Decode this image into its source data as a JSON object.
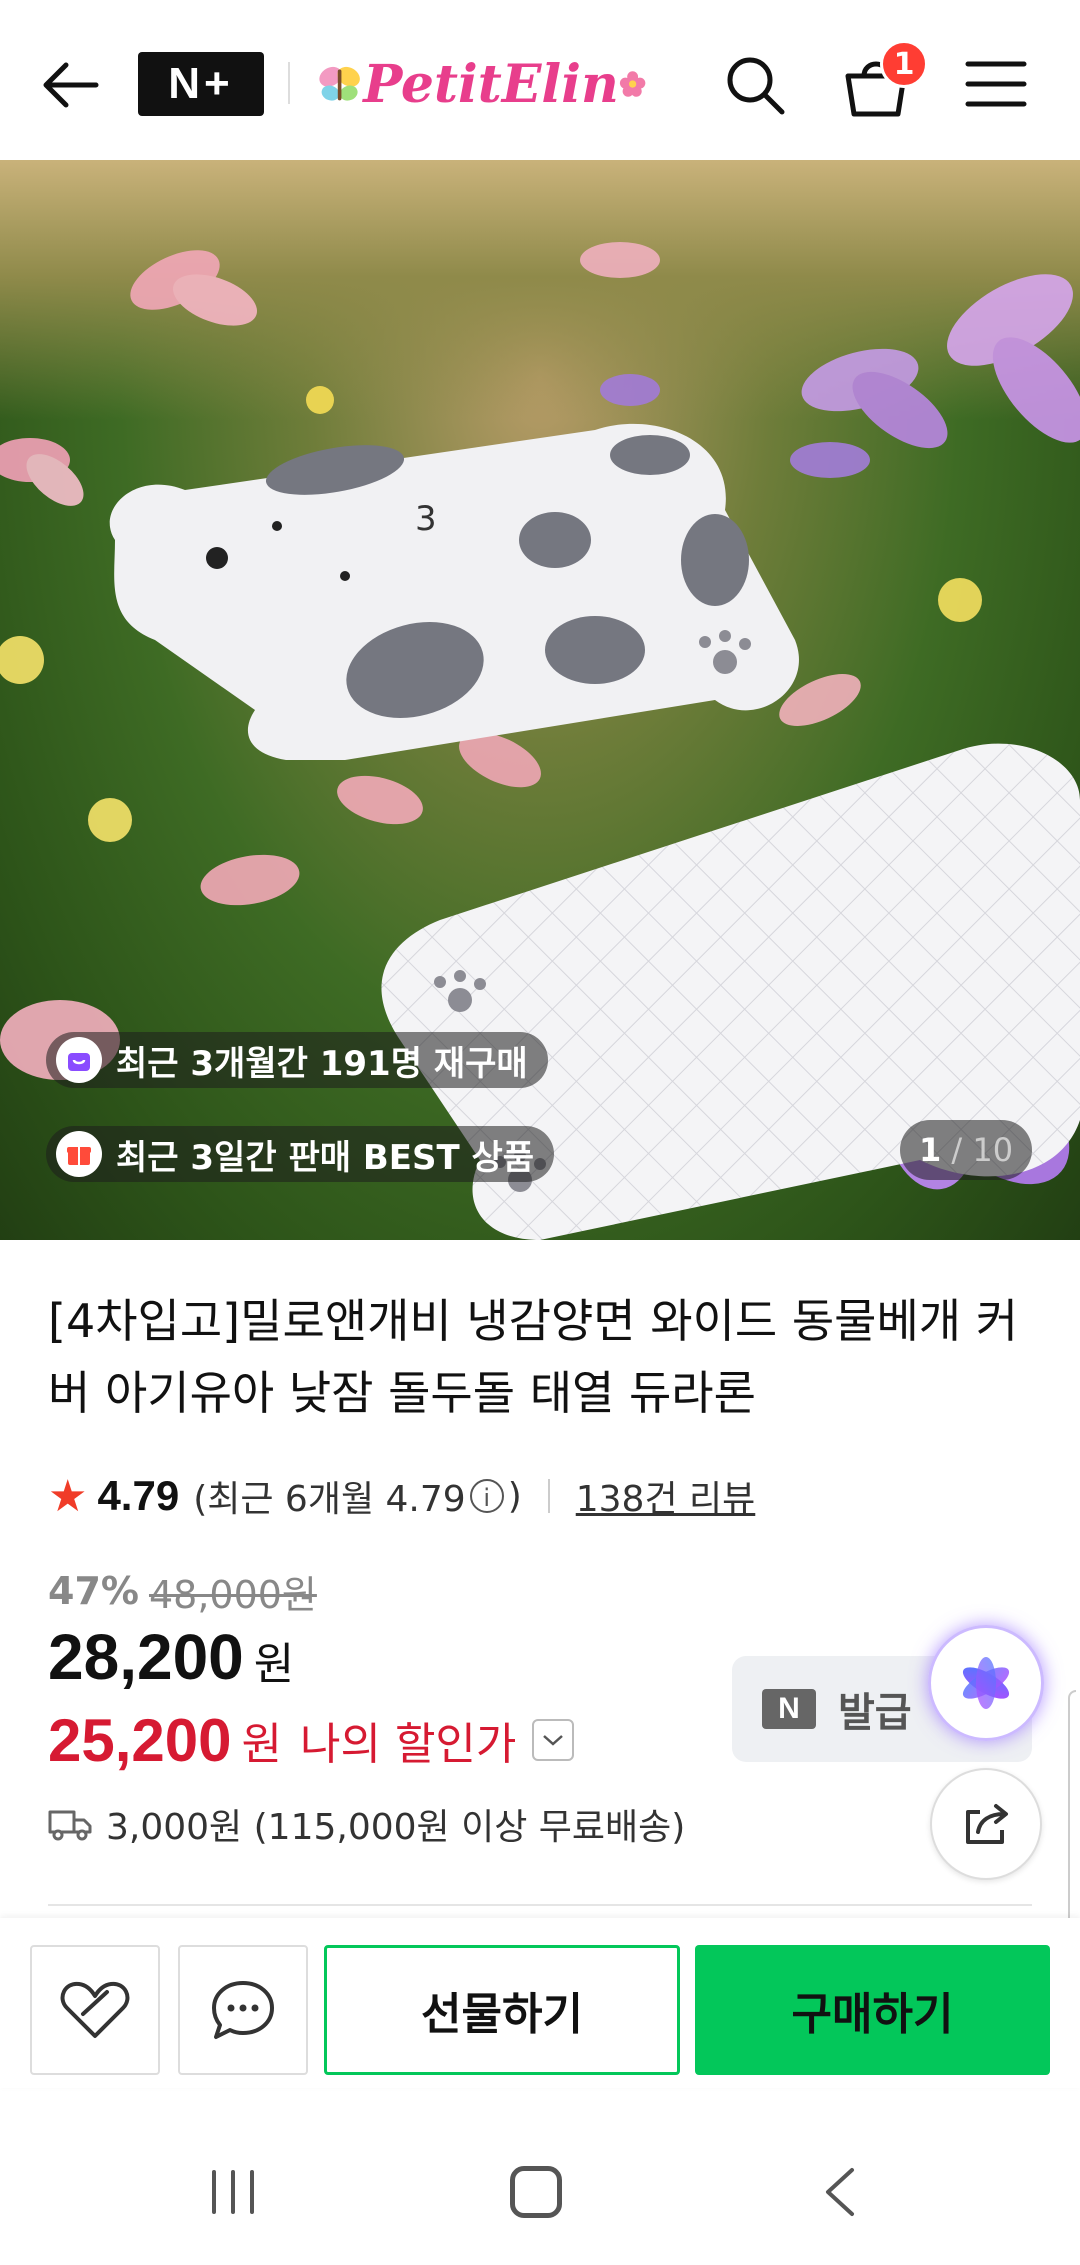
{
  "header": {
    "nplus_label": "N+",
    "brand_name": "PetitElin",
    "cart_count": "1",
    "icons": [
      "back-arrow-icon",
      "search-icon",
      "cart-icon",
      "menu-icon"
    ]
  },
  "hero": {
    "badges": [
      {
        "icon": "bag-icon",
        "text": "최근 3개월간 191명 재구매",
        "icon_color": "#8a4cff"
      },
      {
        "icon": "gift-box-icon",
        "text": "최근 3일간 판매 BEST 상품",
        "icon_color": "#ff4b3a"
      }
    ],
    "pager_current": "1",
    "pager_total": "10"
  },
  "product": {
    "title": "[4차입고]밀로앤개비 냉감양면 와이드 동물베개 커버 아기유아 낮잠 돌두돌 태열 듀라론",
    "rating": "4.79",
    "rating_recent_prefix": "(최근 6개월 4.79",
    "rating_recent_suffix": ")",
    "review_link": "138건 리뷰",
    "discount_rate": "47%",
    "original_price": "48,000원",
    "price": "28,200",
    "price_unit": "원",
    "my_price": "25,200",
    "my_price_unit": "원",
    "my_price_label": "나의 할인가",
    "coupon_label": "발급",
    "coupon_badge": "N",
    "shipping": "3,000원 (115,000원 이상 무료배송)"
  },
  "actions": {
    "gift_label": "선물하기",
    "buy_label": "구매하기",
    "brand_green": "#03c75a"
  }
}
